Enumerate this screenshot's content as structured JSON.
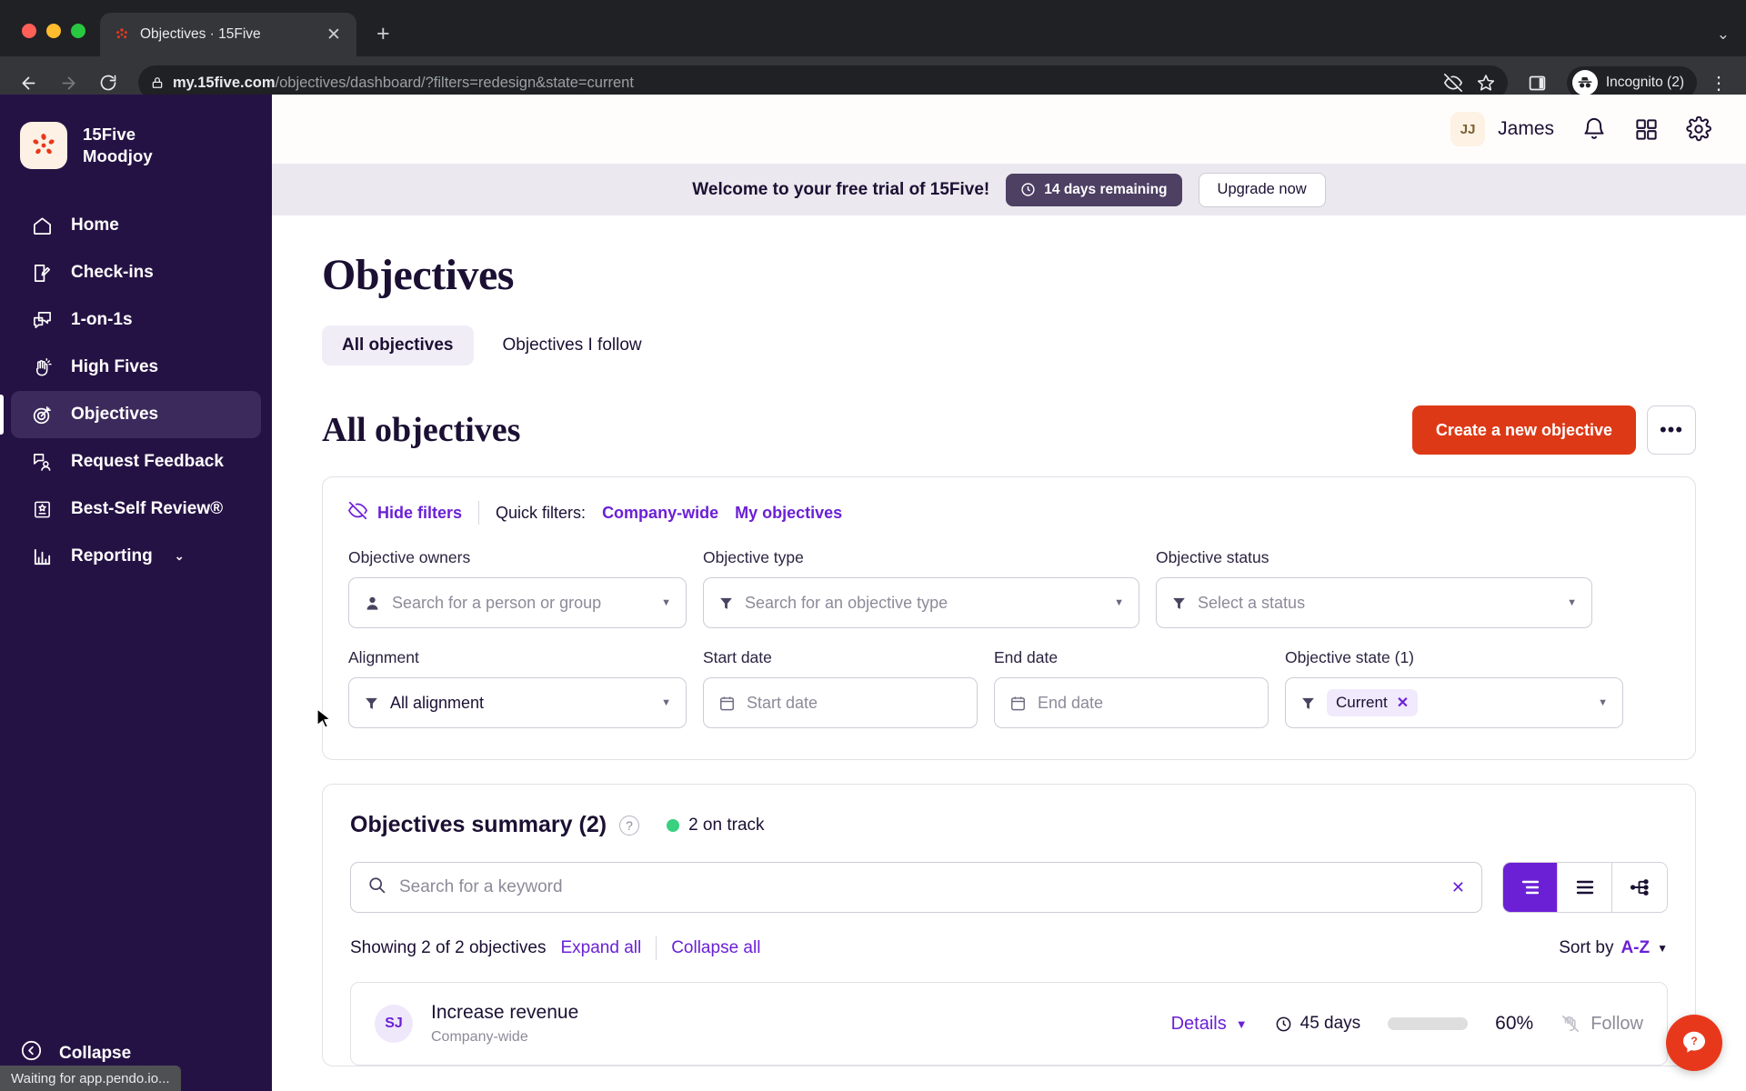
{
  "browser": {
    "tab": {
      "title": "Objectives · 15Five",
      "favicon_icon": "15five-logo-icon",
      "close_icon": "close-icon"
    },
    "new_tab_icon": "plus-icon",
    "tabstrip_menu_icon": "chevron-down-icon",
    "back_icon": "back-arrow-icon",
    "forward_icon": "forward-arrow-icon",
    "reload_icon": "reload-icon",
    "lock_icon": "lock-icon",
    "url_host": "my.15five.com",
    "url_path": "/objectives/dashboard/?filters=redesign&state=current",
    "url_full": "my.15five.com/objectives/dashboard/?filters=redesign&state=current",
    "tracking_icon": "eye-off-icon",
    "bookmark_icon": "star-icon",
    "sidepanel_icon": "side-panel-icon",
    "profile": {
      "label": "Incognito (2)",
      "icon": "incognito-icon"
    },
    "menu_icon": "three-dots-vertical-icon"
  },
  "status_bar": {
    "text": "Waiting for app.pendo.io..."
  },
  "sidebar": {
    "brand": {
      "line1": "15Five",
      "line2": "Moodjoy",
      "logo_icon": "15five-logo-icon"
    },
    "items": [
      {
        "label": "Home",
        "icon": "home-icon",
        "active": false
      },
      {
        "label": "Check-ins",
        "icon": "check-ins-icon",
        "active": false
      },
      {
        "label": "1-on-1s",
        "icon": "one-on-ones-icon",
        "active": false
      },
      {
        "label": "High Fives",
        "icon": "high-fives-icon",
        "active": false
      },
      {
        "label": "Objectives",
        "icon": "target-icon",
        "active": true
      },
      {
        "label": "Request Feedback",
        "icon": "request-feedback-icon",
        "active": false
      },
      {
        "label": "Best-Self Review®",
        "icon": "best-self-review-icon",
        "active": false
      },
      {
        "label": "Reporting",
        "icon": "reporting-icon",
        "active": false,
        "has_chevron": true
      }
    ],
    "collapse": {
      "label": "Collapse",
      "icon": "collapse-left-icon"
    }
  },
  "header": {
    "user": {
      "initials": "JJ",
      "name": "James"
    },
    "notifications_icon": "bell-icon",
    "apps_icon": "grid-apps-icon",
    "settings_icon": "gear-icon"
  },
  "trial_banner": {
    "message": "Welcome to your free trial of 15Five!",
    "days_pill": "14 days remaining",
    "days_pill_icon": "clock-icon",
    "upgrade_label": "Upgrade now"
  },
  "page": {
    "title": "Objectives",
    "tabs": [
      {
        "label": "All objectives",
        "active": true
      },
      {
        "label": "Objectives I follow",
        "active": false
      }
    ],
    "section_title": "All objectives",
    "create_button": "Create a new objective",
    "more_button_icon": "ellipsis-icon"
  },
  "filters": {
    "hide_filters_label": "Hide filters",
    "hide_filters_icon": "eye-off-icon",
    "quick_filters_label": "Quick filters:",
    "quick_links": [
      "Company-wide",
      "My objectives"
    ],
    "fields": [
      {
        "label": "Objective owners",
        "placeholder": "Search for a person or group",
        "value": "",
        "icon": "person-icon"
      },
      {
        "label": "Objective type",
        "placeholder": "Search for an objective type",
        "value": "",
        "icon": "filter-icon"
      },
      {
        "label": "Objective status",
        "placeholder": "Select a status",
        "value": "",
        "icon": "filter-icon"
      },
      {
        "label": "Alignment",
        "placeholder": "",
        "value": "All alignment",
        "icon": "filter-icon"
      },
      {
        "label": "Start date",
        "placeholder": "Start date",
        "value": "",
        "icon": "calendar-icon"
      },
      {
        "label": "End date",
        "placeholder": "End date",
        "value": "",
        "icon": "calendar-icon"
      },
      {
        "label": "Objective state (1)",
        "placeholder": "",
        "value": "",
        "icon": "filter-icon",
        "chip": "Current"
      }
    ]
  },
  "summary": {
    "title": "Objectives summary (2)",
    "help_icon": "question-mark-icon",
    "on_track": "2 on track",
    "search_placeholder": "Search for a keyword",
    "search_value": "",
    "search_icon": "search-icon",
    "search_clear_icon": "clear-x-icon",
    "views": [
      {
        "name": "tree-view",
        "active": true
      },
      {
        "name": "list-view",
        "active": false
      },
      {
        "name": "hierarchy-view",
        "active": false
      }
    ],
    "showing_text": "Showing 2 of 2 objectives",
    "expand_all": "Expand all",
    "collapse_all": "Collapse all",
    "sort_label": "Sort by",
    "sort_value": "A-Z"
  },
  "objectives": [
    {
      "avatar": "SJ",
      "name": "Increase revenue",
      "sub": "Company-wide",
      "details_label": "Details",
      "days": "45 days",
      "days_icon": "clock-icon",
      "progress": 60,
      "progress_label": "60%",
      "follow_label": "Follow",
      "follow_icon": "follow-off-icon"
    }
  ],
  "help_fab": {
    "icon": "help-chat-icon"
  },
  "colors": {
    "sidebar_bg": "#251244",
    "accent_purple": "#6b20d6",
    "primary_red": "#dd3917",
    "trial_bar": "#ebe8ef",
    "green": "#4ddb8a"
  }
}
